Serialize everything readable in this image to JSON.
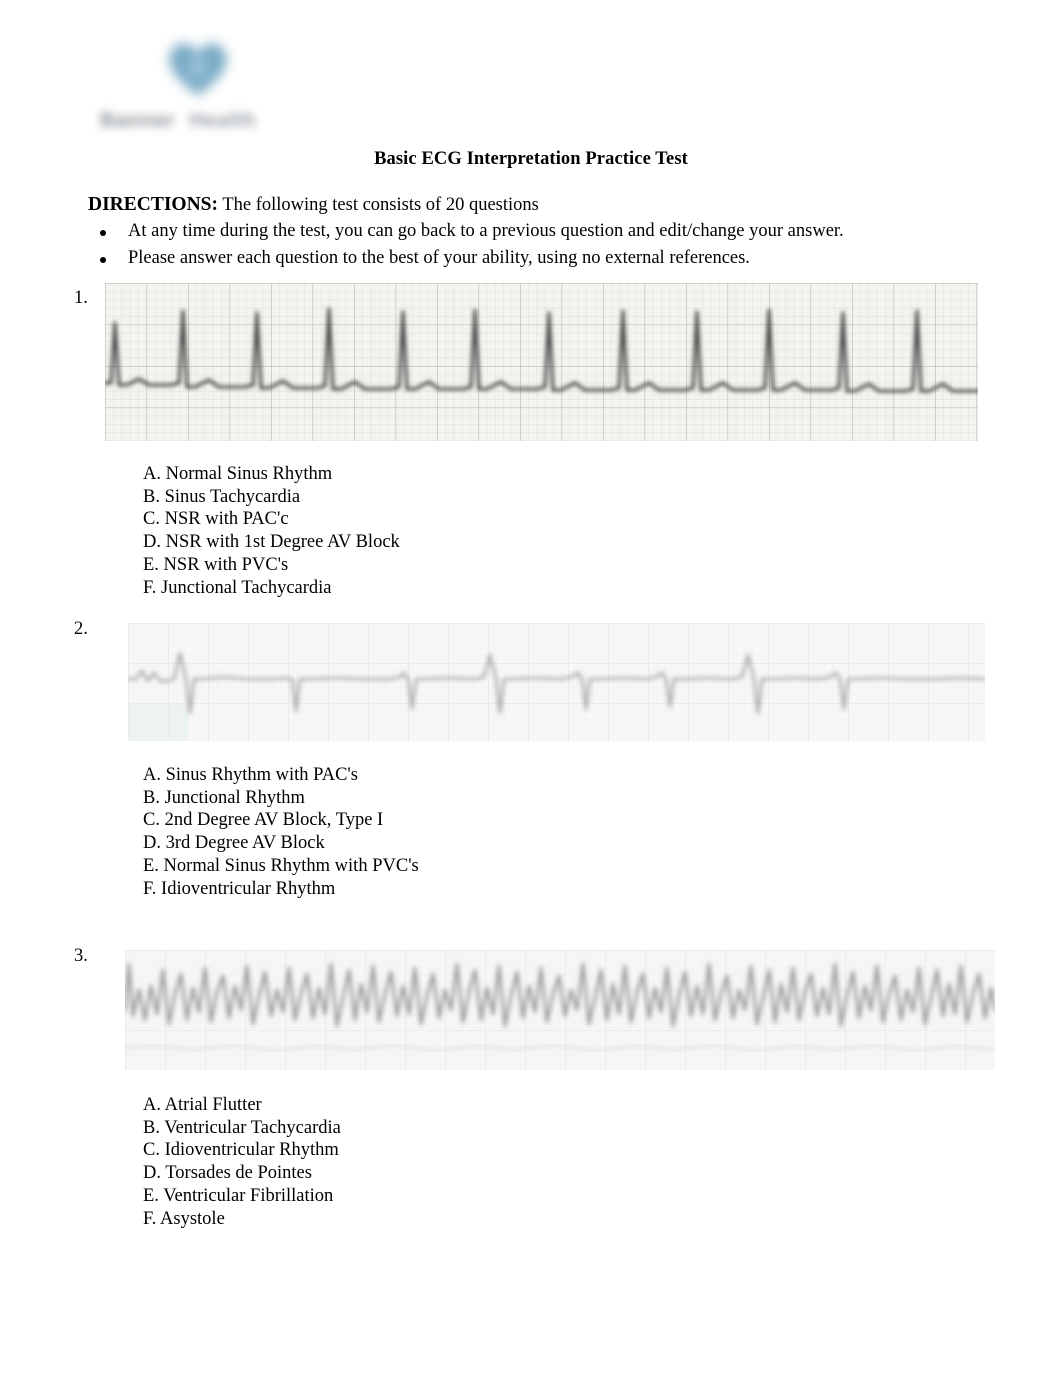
{
  "document": {
    "title": "Basic ECG Interpretation Practice Test",
    "logo": {
      "icon": "heart-icon",
      "heart_color": "#6ea3c0",
      "wordmark_word1": "Banner",
      "wordmark_word2": "Health",
      "wordmark_color": "#8d9399"
    },
    "directions": {
      "label": "DIRECTIONS:",
      "text": "The following test consists of 20 questions",
      "bullets": [
        "At any time during the test, you can go back to a previous question and edit/change your answer.",
        "Please answer each question to the best of your ability, using no external references."
      ]
    },
    "questions": [
      {
        "number": "1.",
        "strip_name": "ecg-strip-question-1",
        "strip_kind": "regular-narrow-qrs",
        "options": [
          "A. Normal Sinus Rhythm",
          "B. Sinus Tachycardia",
          "C. NSR with PAC'c",
          "D. NSR with 1st Degree AV Block",
          "E. NSR with PVC's",
          "F. Junctional Tachycardia"
        ]
      },
      {
        "number": "2.",
        "strip_name": "ecg-strip-question-2",
        "strip_kind": "sparse-faint-complexes",
        "options": [
          "A. Sinus Rhythm with PAC's",
          "B. Junctional Rhythm",
          "C. 2nd Degree AV Block, Type I",
          "D. 3rd Degree AV Block",
          "E. Normal Sinus Rhythm with PVC's",
          "F. Idioventricular Rhythm"
        ]
      },
      {
        "number": "3.",
        "strip_name": "ecg-strip-question-3",
        "strip_kind": "chaotic-dense",
        "options": [
          "A. Atrial Flutter",
          "B. Ventricular Tachycardia",
          "C. Idioventricular Rhythm",
          "D. Torsades de Pointes",
          "E. Ventricular Fibrillation",
          "F. Asystole"
        ]
      }
    ]
  }
}
